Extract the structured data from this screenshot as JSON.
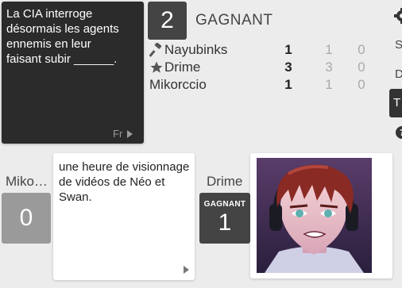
{
  "black_card": {
    "text": "La CIA interroge désormais les agents ennemis en leur faisant subir ______.",
    "language": "Fr"
  },
  "round": {
    "number": "2",
    "status": "GAGNANT"
  },
  "scoreboard": [
    {
      "name": "Nayubinks",
      "icon": "gavel-icon",
      "points": "1",
      "col2": "1",
      "col3": "0"
    },
    {
      "name": "Drime",
      "icon": "star-icon",
      "points": "3",
      "col2": "3",
      "col3": "0"
    },
    {
      "name": "Mikorccio",
      "icon": "",
      "points": "1",
      "col2": "1",
      "col3": "0"
    }
  ],
  "edge": {
    "s": "S",
    "d": "D",
    "t": "T"
  },
  "players": [
    {
      "name": "Miko…",
      "score": "0"
    },
    {
      "name": "Drime",
      "badge": "GAGNANT",
      "score": "1"
    }
  ],
  "white_card": {
    "text": "une heure de visionnage de vidéos de Néo et Swan."
  },
  "colors": {
    "dark": "#2b2b2b",
    "card_gray": "#444444",
    "muted_gray": "#9a9a9a",
    "background": "#ececec"
  }
}
